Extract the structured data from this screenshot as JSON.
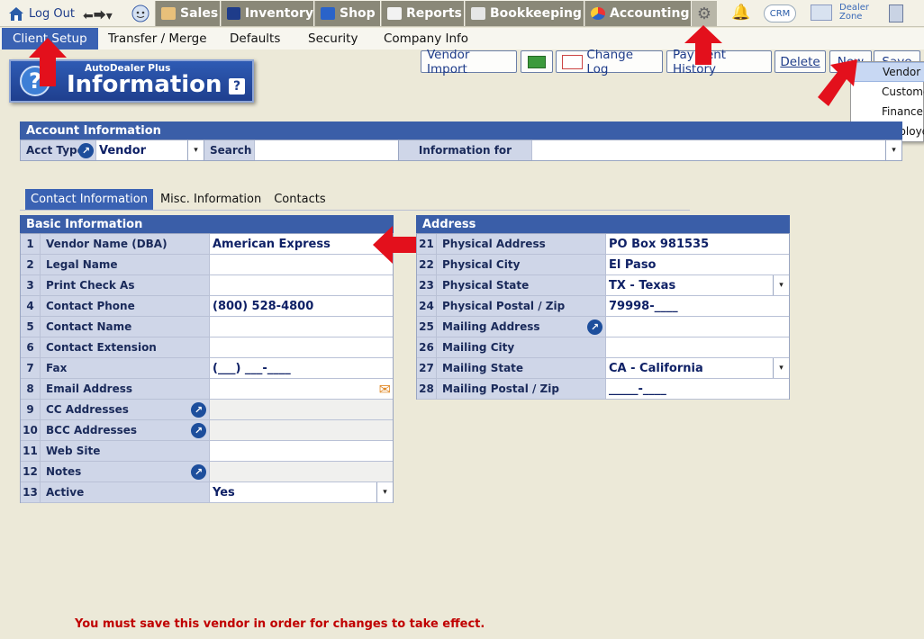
{
  "topnav": {
    "logout": "Log Out",
    "sales": "Sales",
    "inventory": "Inventory",
    "shop": "Shop",
    "reports": "Reports",
    "bookkeeping": "Bookkeeping",
    "accounting": "Accounting",
    "crm": "CRM",
    "dealer_zone_line1": "Dealer",
    "dealer_zone_line2": "Zone"
  },
  "submenu": {
    "client_setup": "Client Setup",
    "transfer_merge": "Transfer / Merge",
    "defaults": "Defaults",
    "security": "Security",
    "company_info": "Company Info"
  },
  "logo": {
    "subtitle": "AutoDealer Plus",
    "title": "Information",
    "help": "?"
  },
  "toolbar": {
    "vendor_import": "Vendor Import",
    "change_log": "Change Log",
    "payment_history": "Payment History",
    "delete": "Delete",
    "new": "New",
    "save": "Save"
  },
  "new_menu": {
    "items": [
      "Vendor",
      "Customer",
      "Finance Co",
      "Employee"
    ]
  },
  "account": {
    "header": "Account Information",
    "acct_type_label": "Acct Type",
    "acct_type_value": "Vendor",
    "search_label": "Search",
    "search_value": "",
    "info_for_label": "Information for",
    "info_for_value": ""
  },
  "tabs": [
    "Contact Information",
    "Misc. Information",
    "Contacts"
  ],
  "basic": {
    "header": "Basic Information",
    "rows": [
      {
        "num": "1",
        "label": "Vendor Name (DBA)",
        "value": "American Express"
      },
      {
        "num": "2",
        "label": "Legal Name",
        "value": ""
      },
      {
        "num": "3",
        "label": "Print Check As",
        "value": ""
      },
      {
        "num": "4",
        "label": "Contact Phone",
        "value": "(800) 528-4800"
      },
      {
        "num": "5",
        "label": "Contact Name",
        "value": ""
      },
      {
        "num": "6",
        "label": "Contact Extension",
        "value": ""
      },
      {
        "num": "7",
        "label": "Fax",
        "value": "(___) ___-____"
      },
      {
        "num": "8",
        "label": "Email Address",
        "value": ""
      },
      {
        "num": "9",
        "label": "CC Addresses",
        "value": ""
      },
      {
        "num": "10",
        "label": "BCC Addresses",
        "value": ""
      },
      {
        "num": "11",
        "label": "Web Site",
        "value": ""
      },
      {
        "num": "12",
        "label": "Notes",
        "value": ""
      },
      {
        "num": "13",
        "label": "Active",
        "value": "Yes"
      }
    ]
  },
  "address": {
    "header": "Address",
    "rows": [
      {
        "num": "21",
        "label": "Physical Address",
        "value": "PO Box 981535"
      },
      {
        "num": "22",
        "label": "Physical City",
        "value": "El Paso"
      },
      {
        "num": "23",
        "label": "Physical State",
        "value": "TX - Texas"
      },
      {
        "num": "24",
        "label": "Physical Postal / Zip",
        "value": "79998-____"
      },
      {
        "num": "25",
        "label": "Mailing Address",
        "value": ""
      },
      {
        "num": "26",
        "label": "Mailing City",
        "value": ""
      },
      {
        "num": "27",
        "label": "Mailing State",
        "value": "CA - California"
      },
      {
        "num": "28",
        "label": "Mailing Postal / Zip",
        "value": "_____-____"
      }
    ]
  },
  "footer_message": "You must save this vendor in order for changes to take effect.",
  "colors": {
    "accent": "#3a5ea8",
    "nav": "#8a8878",
    "warning": "#c00000",
    "arrow": "#e3101c"
  }
}
